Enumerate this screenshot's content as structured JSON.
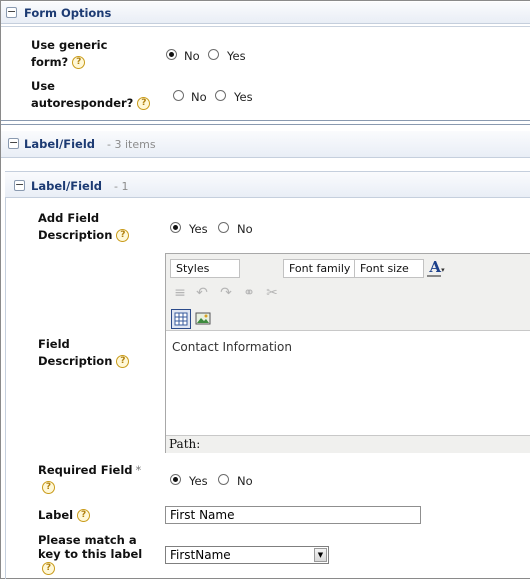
{
  "form_options": {
    "title": "Form Options",
    "generic_form": {
      "label": "Use generic form?",
      "options": [
        "No",
        "Yes"
      ],
      "selected": "No"
    },
    "autoresponder": {
      "label": "Use autoresponder?",
      "options": [
        "No",
        "Yes"
      ],
      "selected": null
    }
  },
  "label_field_section": {
    "title": "Label/Field",
    "count": "- 3 items"
  },
  "item": {
    "title": "Label/Field",
    "count": "- 1",
    "add_description": {
      "label": "Add Field Description",
      "options": [
        "Yes",
        "No"
      ],
      "selected": "Yes"
    },
    "field_description": {
      "label": "Field Description",
      "toolbar": {
        "styles": "Styles",
        "font_family": "Font family",
        "font_size": "Font size"
      },
      "toolbar_icons": [
        "text-color-icon",
        "align-icon",
        "undo-icon",
        "redo-icon",
        "link-icon",
        "unlink-icon",
        "table-icon",
        "image-icon"
      ],
      "content": "Contact Information",
      "path": "Path:"
    },
    "required_field": {
      "label": "Required Field",
      "marker": "*",
      "options": [
        "Yes",
        "No"
      ],
      "selected": "Yes"
    },
    "label": {
      "label": "Label",
      "value": "First Name"
    },
    "match_key": {
      "label": "Please match a key to this label",
      "value": "FirstName"
    }
  },
  "help_glyph": "?",
  "colors": {
    "accent": "#1d3b73",
    "header_bg": "#e9eef6"
  }
}
